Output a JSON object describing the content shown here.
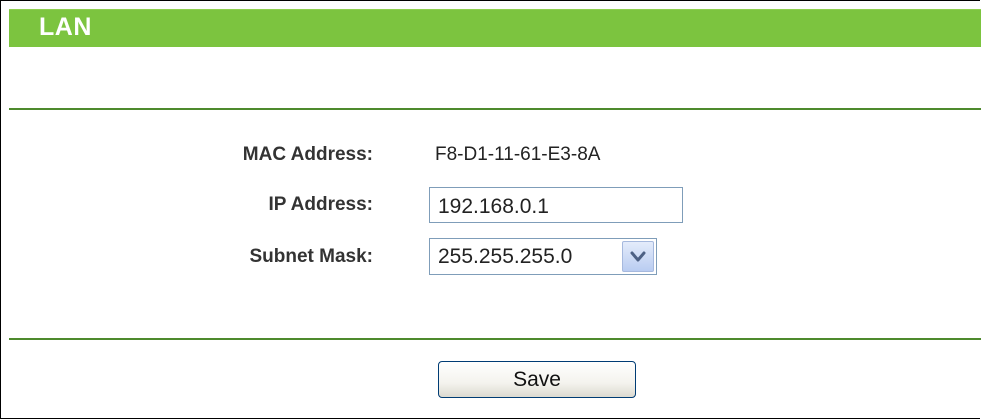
{
  "header": {
    "title": "LAN",
    "color": "#7cc43f"
  },
  "fields": {
    "mac_label": "MAC Address:",
    "mac_value": "F8-D1-11-61-E3-8A",
    "ip_label": "IP Address:",
    "ip_value": "192.168.0.1",
    "mask_label": "Subnet Mask:",
    "mask_value": "255.255.255.0"
  },
  "icons": {
    "mask_dropdown": "chevron-down-icon"
  },
  "actions": {
    "save_label": "Save"
  }
}
